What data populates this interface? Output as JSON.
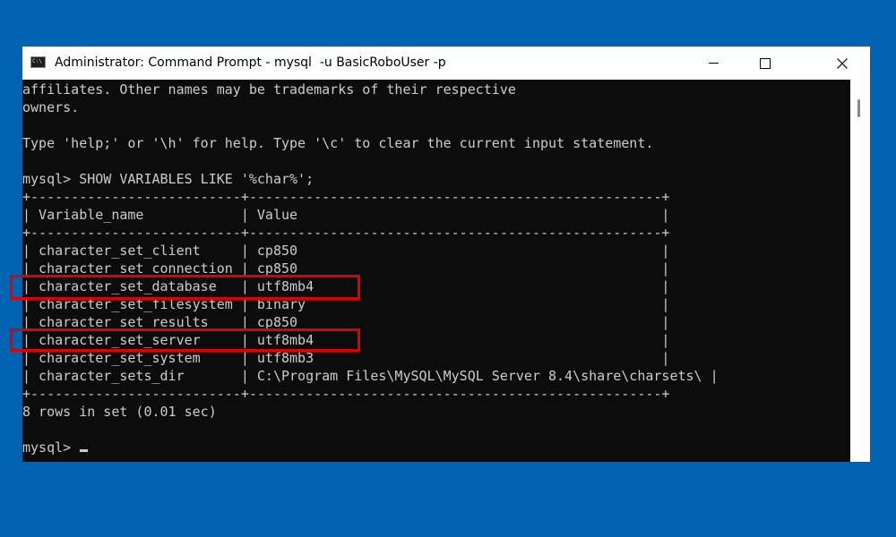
{
  "window": {
    "title": "Administrator: Command Prompt - mysql  -u BasicRoboUser -p",
    "icon": "cmd-icon",
    "controls": [
      "minimize-icon",
      "maximize-icon",
      "close-icon"
    ]
  },
  "console": {
    "lines": [
      "affiliates. Other names may be trademarks of their respective",
      "owners.",
      "",
      "Type 'help;' or '\\h' for help. Type '\\c' to clear the current input statement.",
      "",
      "mysql> SHOW VARIABLES LIKE '%char%';",
      "+--------------------------+---------------------------------------------------+",
      "| Variable_name            | Value                                             |",
      "+--------------------------+---------------------------------------------------+",
      "| character_set_client     | cp850                                             |",
      "| character_set_connection | cp850                                             |",
      "| character_set_database   | utf8mb4                                           |",
      "| character_set_filesystem | binary                                            |",
      "| character_set_results    | cp850                                             |",
      "| character_set_server     | utf8mb4                                           |",
      "| character_set_system     | utf8mb3                                           |",
      "| character_sets_dir       | C:\\Program Files\\MySQL\\MySQL Server 8.4\\share\\charsets\\ |",
      "+--------------------------+---------------------------------------------------+",
      "8 rows in set (0.01 sec)",
      "",
      "mysql> "
    ]
  },
  "annotations": {
    "highlight_color": "#e00000"
  },
  "colors": {
    "desktop": "#0063b1",
    "console_bg": "#0c0c0c",
    "console_text": "#cccccc"
  }
}
